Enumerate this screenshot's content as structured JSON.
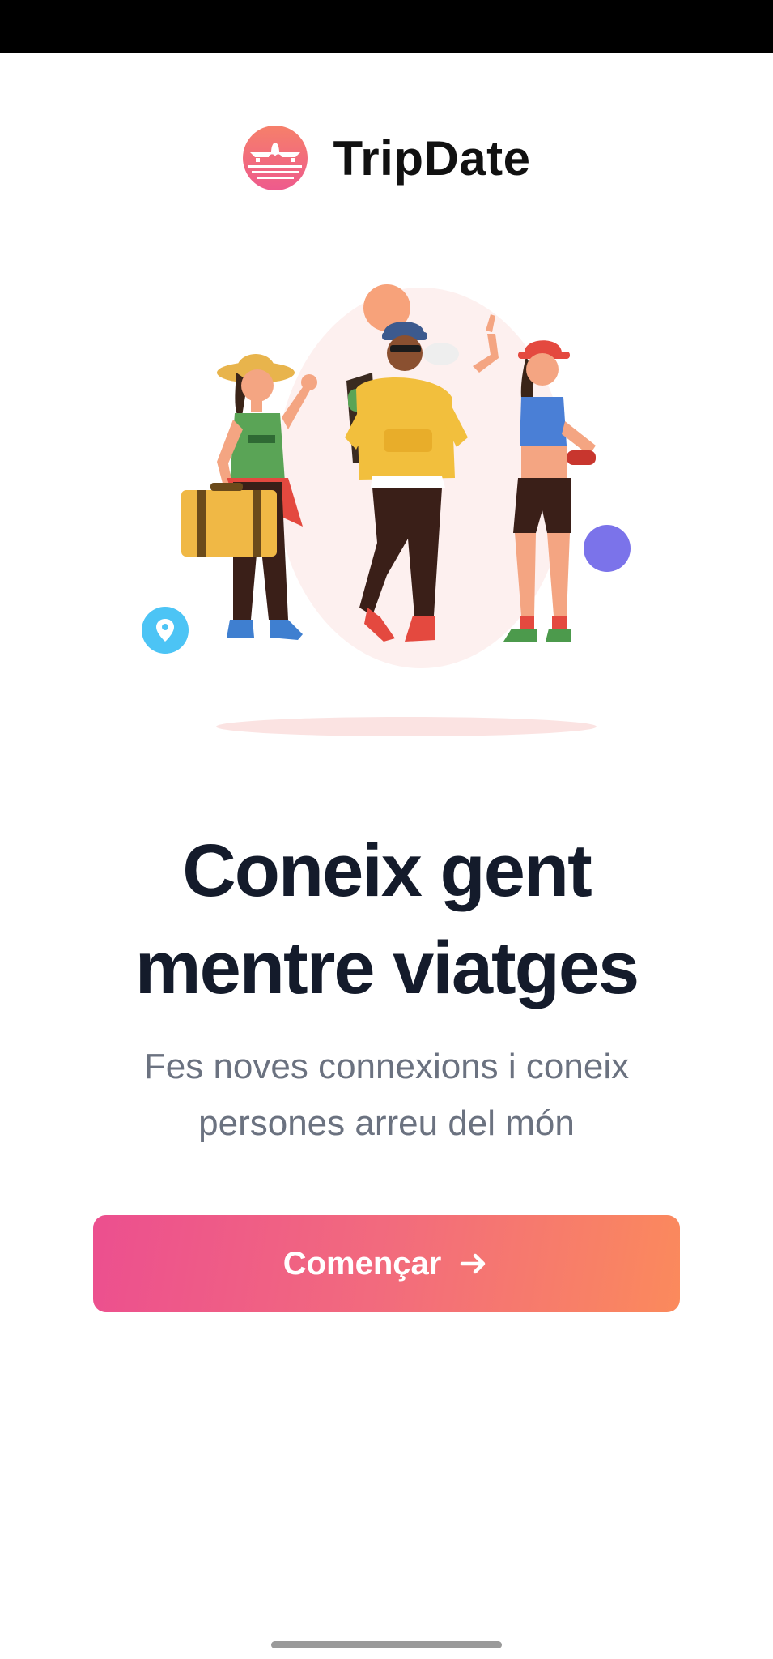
{
  "app": {
    "name": "TripDate"
  },
  "hero": {
    "headline_line1": "Coneix gent",
    "headline_line2": "mentre viatges",
    "subtitle_line1": "Fes noves connexions i coneix",
    "subtitle_line2": "persones arreu del món"
  },
  "cta": {
    "label": "Començar",
    "icon": "arrow-right-icon"
  },
  "colors": {
    "brand_gradient_start": "#ec4f8f",
    "brand_gradient_end": "#fb8a5c",
    "headline": "#141b2b",
    "subtitle": "#6b7280"
  }
}
